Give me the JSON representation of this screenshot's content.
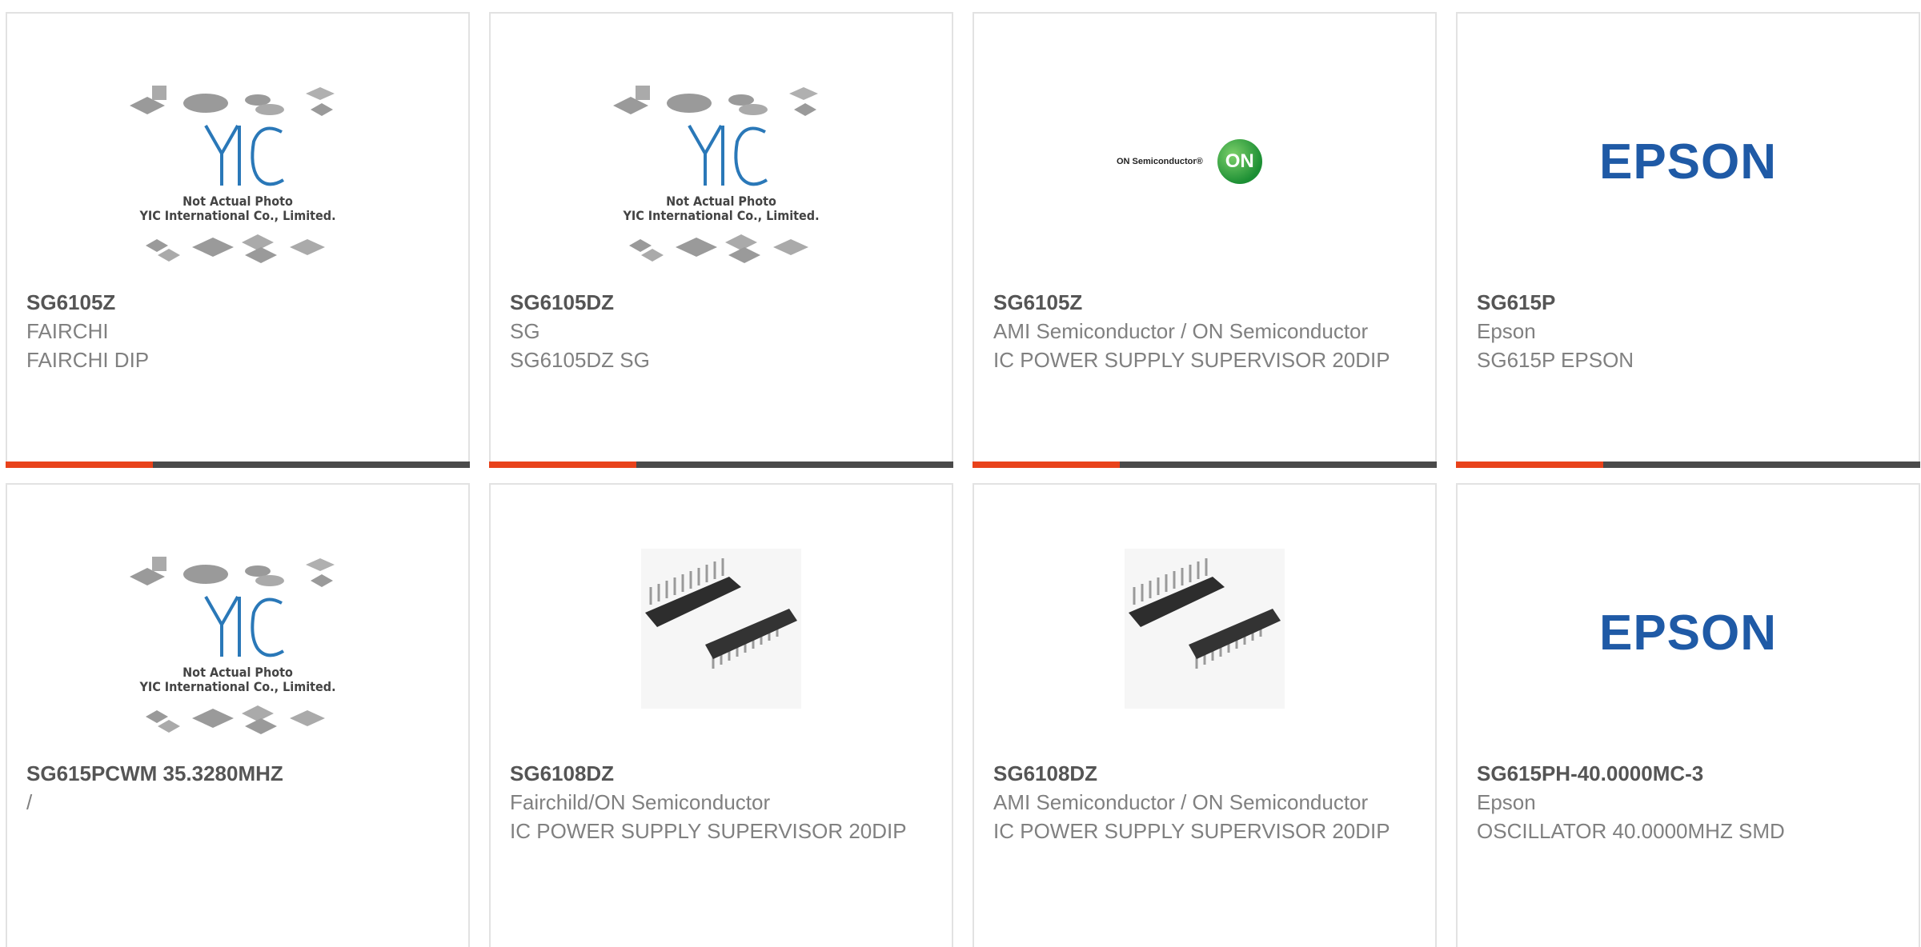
{
  "colors": {
    "accent": "#e8421b",
    "bar": "#4a4a4a",
    "part": "#555555",
    "meta": "#808080",
    "epson": "#1f5aa6"
  },
  "products": [
    {
      "part": "SG6105Z",
      "maker": "FAIRCHI",
      "desc": "FAIRCHI DIP",
      "image": "yic-placeholder",
      "photo_caption": [
        "Not Actual Photo",
        "YIC International Co., Limited."
      ]
    },
    {
      "part": "SG6105DZ",
      "maker": "SG",
      "desc": "SG6105DZ SG",
      "image": "yic-placeholder",
      "photo_caption": [
        "Not Actual Photo",
        "YIC International Co., Limited."
      ]
    },
    {
      "part": "SG6105Z",
      "maker": "AMI Semiconductor / ON Semiconductor",
      "desc": "IC POWER SUPPLY SUPERVISOR 20DIP",
      "image": "on-semiconductor-logo",
      "logo_text": "ON Semiconductor®",
      "logo_badge": "ON"
    },
    {
      "part": "SG615P",
      "maker": "Epson",
      "desc": "SG615P EPSON",
      "image": "epson-logo",
      "logo_text": "EPSON"
    },
    {
      "part": "SG615PCWM 35.3280MHZ",
      "maker": "/",
      "desc": "",
      "image": "yic-placeholder",
      "photo_caption": [
        "Not Actual Photo",
        "YIC International Co., Limited."
      ]
    },
    {
      "part": "SG6108DZ",
      "maker": "Fairchild/ON Semiconductor",
      "desc": "IC POWER SUPPLY SUPERVISOR 20DIP",
      "image": "dip-chip-photo"
    },
    {
      "part": "SG6108DZ",
      "maker": "AMI Semiconductor / ON Semiconductor",
      "desc": "IC POWER SUPPLY SUPERVISOR 20DIP",
      "image": "dip-chip-photo"
    },
    {
      "part": "SG615PH-40.0000MC-3",
      "maker": "Epson",
      "desc": "OSCILLATOR 40.0000MHZ SMD",
      "image": "epson-logo",
      "logo_text": "EPSON"
    }
  ]
}
